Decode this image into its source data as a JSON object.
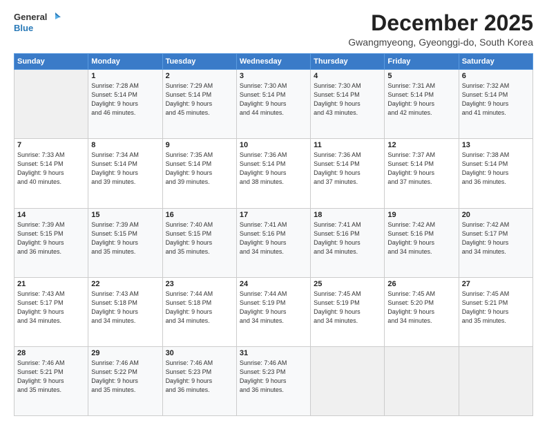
{
  "header": {
    "logo_line1": "General",
    "logo_line2": "Blue",
    "month": "December 2025",
    "location": "Gwangmyeong, Gyeonggi-do, South Korea"
  },
  "days_of_week": [
    "Sunday",
    "Monday",
    "Tuesday",
    "Wednesday",
    "Thursday",
    "Friday",
    "Saturday"
  ],
  "weeks": [
    [
      {
        "day": "",
        "info": ""
      },
      {
        "day": "1",
        "info": "Sunrise: 7:28 AM\nSunset: 5:14 PM\nDaylight: 9 hours\nand 46 minutes."
      },
      {
        "day": "2",
        "info": "Sunrise: 7:29 AM\nSunset: 5:14 PM\nDaylight: 9 hours\nand 45 minutes."
      },
      {
        "day": "3",
        "info": "Sunrise: 7:30 AM\nSunset: 5:14 PM\nDaylight: 9 hours\nand 44 minutes."
      },
      {
        "day": "4",
        "info": "Sunrise: 7:30 AM\nSunset: 5:14 PM\nDaylight: 9 hours\nand 43 minutes."
      },
      {
        "day": "5",
        "info": "Sunrise: 7:31 AM\nSunset: 5:14 PM\nDaylight: 9 hours\nand 42 minutes."
      },
      {
        "day": "6",
        "info": "Sunrise: 7:32 AM\nSunset: 5:14 PM\nDaylight: 9 hours\nand 41 minutes."
      }
    ],
    [
      {
        "day": "7",
        "info": "Sunrise: 7:33 AM\nSunset: 5:14 PM\nDaylight: 9 hours\nand 40 minutes."
      },
      {
        "day": "8",
        "info": "Sunrise: 7:34 AM\nSunset: 5:14 PM\nDaylight: 9 hours\nand 39 minutes."
      },
      {
        "day": "9",
        "info": "Sunrise: 7:35 AM\nSunset: 5:14 PM\nDaylight: 9 hours\nand 39 minutes."
      },
      {
        "day": "10",
        "info": "Sunrise: 7:36 AM\nSunset: 5:14 PM\nDaylight: 9 hours\nand 38 minutes."
      },
      {
        "day": "11",
        "info": "Sunrise: 7:36 AM\nSunset: 5:14 PM\nDaylight: 9 hours\nand 37 minutes."
      },
      {
        "day": "12",
        "info": "Sunrise: 7:37 AM\nSunset: 5:14 PM\nDaylight: 9 hours\nand 37 minutes."
      },
      {
        "day": "13",
        "info": "Sunrise: 7:38 AM\nSunset: 5:14 PM\nDaylight: 9 hours\nand 36 minutes."
      }
    ],
    [
      {
        "day": "14",
        "info": "Sunrise: 7:39 AM\nSunset: 5:15 PM\nDaylight: 9 hours\nand 36 minutes."
      },
      {
        "day": "15",
        "info": "Sunrise: 7:39 AM\nSunset: 5:15 PM\nDaylight: 9 hours\nand 35 minutes."
      },
      {
        "day": "16",
        "info": "Sunrise: 7:40 AM\nSunset: 5:15 PM\nDaylight: 9 hours\nand 35 minutes."
      },
      {
        "day": "17",
        "info": "Sunrise: 7:41 AM\nSunset: 5:16 PM\nDaylight: 9 hours\nand 34 minutes."
      },
      {
        "day": "18",
        "info": "Sunrise: 7:41 AM\nSunset: 5:16 PM\nDaylight: 9 hours\nand 34 minutes."
      },
      {
        "day": "19",
        "info": "Sunrise: 7:42 AM\nSunset: 5:16 PM\nDaylight: 9 hours\nand 34 minutes."
      },
      {
        "day": "20",
        "info": "Sunrise: 7:42 AM\nSunset: 5:17 PM\nDaylight: 9 hours\nand 34 minutes."
      }
    ],
    [
      {
        "day": "21",
        "info": "Sunrise: 7:43 AM\nSunset: 5:17 PM\nDaylight: 9 hours\nand 34 minutes."
      },
      {
        "day": "22",
        "info": "Sunrise: 7:43 AM\nSunset: 5:18 PM\nDaylight: 9 hours\nand 34 minutes."
      },
      {
        "day": "23",
        "info": "Sunrise: 7:44 AM\nSunset: 5:18 PM\nDaylight: 9 hours\nand 34 minutes."
      },
      {
        "day": "24",
        "info": "Sunrise: 7:44 AM\nSunset: 5:19 PM\nDaylight: 9 hours\nand 34 minutes."
      },
      {
        "day": "25",
        "info": "Sunrise: 7:45 AM\nSunset: 5:19 PM\nDaylight: 9 hours\nand 34 minutes."
      },
      {
        "day": "26",
        "info": "Sunrise: 7:45 AM\nSunset: 5:20 PM\nDaylight: 9 hours\nand 34 minutes."
      },
      {
        "day": "27",
        "info": "Sunrise: 7:45 AM\nSunset: 5:21 PM\nDaylight: 9 hours\nand 35 minutes."
      }
    ],
    [
      {
        "day": "28",
        "info": "Sunrise: 7:46 AM\nSunset: 5:21 PM\nDaylight: 9 hours\nand 35 minutes."
      },
      {
        "day": "29",
        "info": "Sunrise: 7:46 AM\nSunset: 5:22 PM\nDaylight: 9 hours\nand 35 minutes."
      },
      {
        "day": "30",
        "info": "Sunrise: 7:46 AM\nSunset: 5:23 PM\nDaylight: 9 hours\nand 36 minutes."
      },
      {
        "day": "31",
        "info": "Sunrise: 7:46 AM\nSunset: 5:23 PM\nDaylight: 9 hours\nand 36 minutes."
      },
      {
        "day": "",
        "info": ""
      },
      {
        "day": "",
        "info": ""
      },
      {
        "day": "",
        "info": ""
      }
    ]
  ]
}
